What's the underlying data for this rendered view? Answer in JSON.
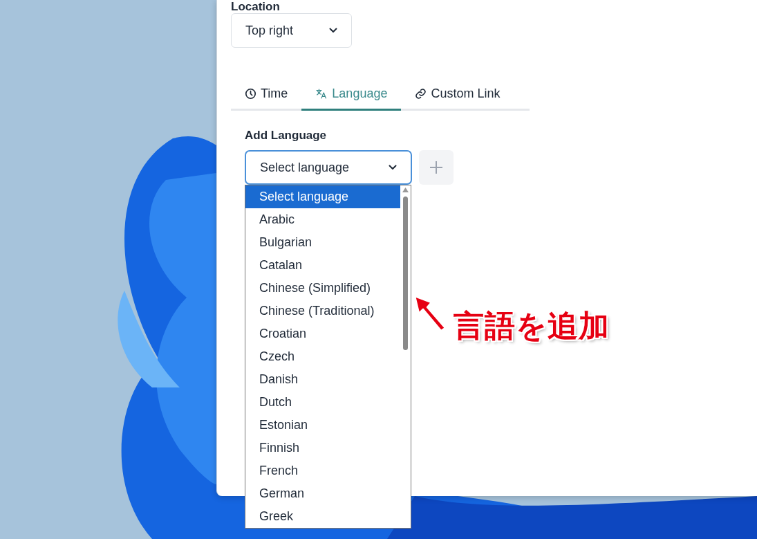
{
  "location": {
    "label": "Location",
    "value": "Top right"
  },
  "tabs": [
    {
      "label": "Time",
      "kind": "clock",
      "selected": false
    },
    {
      "label": "Language",
      "kind": "translate",
      "selected": true
    },
    {
      "label": "Custom Link",
      "kind": "link",
      "selected": false
    }
  ],
  "add_language": {
    "label": "Add Language",
    "value": "Select language",
    "expanded": true
  },
  "options": [
    {
      "label": "Select language",
      "selected": true
    },
    {
      "label": "Arabic",
      "selected": false
    },
    {
      "label": "Bulgarian",
      "selected": false
    },
    {
      "label": "Catalan",
      "selected": false
    },
    {
      "label": "Chinese (Simplified)",
      "selected": false
    },
    {
      "label": "Chinese (Traditional)",
      "selected": false
    },
    {
      "label": "Croatian",
      "selected": false
    },
    {
      "label": "Czech",
      "selected": false
    },
    {
      "label": "Danish",
      "selected": false
    },
    {
      "label": "Dutch",
      "selected": false
    },
    {
      "label": "Estonian",
      "selected": false
    },
    {
      "label": "Finnish",
      "selected": false
    },
    {
      "label": "French",
      "selected": false
    },
    {
      "label": "German",
      "selected": false
    },
    {
      "label": "Greek",
      "selected": false
    }
  ],
  "annotation": {
    "text": "言語を追加"
  }
}
